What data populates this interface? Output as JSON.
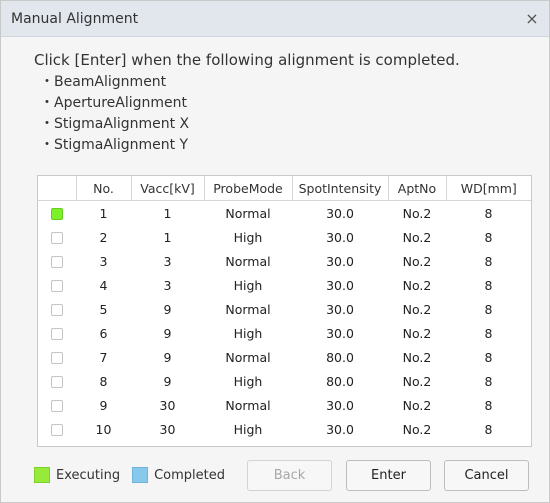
{
  "dialog": {
    "title": "Manual Alignment",
    "close_icon": "×",
    "instruction": "Click [Enter] when the following alignment is completed.",
    "steps": [
      "・BeamAlignment",
      "・ApertureAlignment",
      "・StigmaAlignment X",
      "・StigmaAlignment Y"
    ]
  },
  "table": {
    "headers": [
      "",
      "No.",
      "Vacc[kV]",
      "ProbeMode",
      "SpotIntensity",
      "AptNo",
      "WD[mm]"
    ],
    "rows": [
      {
        "status": "executing",
        "no": "1",
        "vacc": "1",
        "probe": "Normal",
        "spot": "30.0",
        "apt": "No.2",
        "wd": "8"
      },
      {
        "status": "",
        "no": "2",
        "vacc": "1",
        "probe": "High",
        "spot": "30.0",
        "apt": "No.2",
        "wd": "8"
      },
      {
        "status": "",
        "no": "3",
        "vacc": "3",
        "probe": "Normal",
        "spot": "30.0",
        "apt": "No.2",
        "wd": "8"
      },
      {
        "status": "",
        "no": "4",
        "vacc": "3",
        "probe": "High",
        "spot": "30.0",
        "apt": "No.2",
        "wd": "8"
      },
      {
        "status": "",
        "no": "5",
        "vacc": "9",
        "probe": "Normal",
        "spot": "30.0",
        "apt": "No.2",
        "wd": "8"
      },
      {
        "status": "",
        "no": "6",
        "vacc": "9",
        "probe": "High",
        "spot": "30.0",
        "apt": "No.2",
        "wd": "8"
      },
      {
        "status": "",
        "no": "7",
        "vacc": "9",
        "probe": "Normal",
        "spot": "80.0",
        "apt": "No.2",
        "wd": "8"
      },
      {
        "status": "",
        "no": "8",
        "vacc": "9",
        "probe": "High",
        "spot": "80.0",
        "apt": "No.2",
        "wd": "8"
      },
      {
        "status": "",
        "no": "9",
        "vacc": "30",
        "probe": "Normal",
        "spot": "30.0",
        "apt": "No.2",
        "wd": "8"
      },
      {
        "status": "",
        "no": "10",
        "vacc": "30",
        "probe": "High",
        "spot": "30.0",
        "apt": "No.2",
        "wd": "8"
      }
    ]
  },
  "legend": {
    "executing": "Executing",
    "completed": "Completed"
  },
  "buttons": {
    "back": "Back",
    "enter": "Enter",
    "cancel": "Cancel"
  },
  "colors": {
    "executing": "#97ea3a",
    "completed": "#87c9ec",
    "titlebar": "#e2e7ed"
  }
}
